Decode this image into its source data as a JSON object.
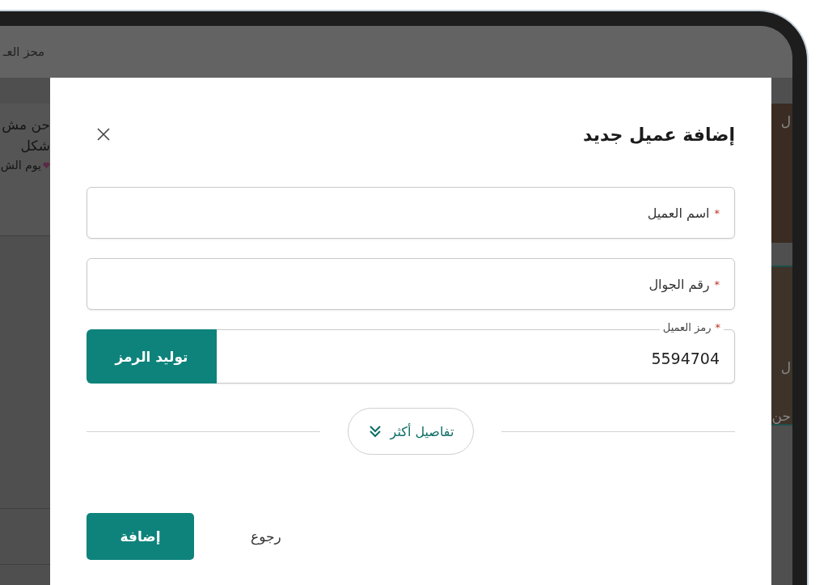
{
  "background": {
    "header_text": "محز العـ",
    "left_texts": [
      {
        "text": "حن مش",
        "icon": false
      },
      {
        "text": "شكل",
        "icon": false
      },
      {
        "text": "يوم الش",
        "icon": true
      }
    ],
    "right_texts": [
      "ل",
      "ل",
      "حن"
    ]
  },
  "dialog": {
    "title": "إضافة عميل جديد",
    "fields": [
      {
        "kind": "text",
        "mark": "*",
        "label": "اسم العميل"
      },
      {
        "kind": "text",
        "mark": "*",
        "label": "رقم الجوال"
      },
      {
        "kind": "code",
        "mark": "*",
        "label": "رمز العميل",
        "value": "5594704",
        "button": "توليد الرمز"
      }
    ],
    "more_button": "تفاصيل أكثر",
    "actions": [
      {
        "kind": "text",
        "label": "رجوع"
      },
      {
        "kind": "primary",
        "label": "إضافة"
      }
    ]
  }
}
